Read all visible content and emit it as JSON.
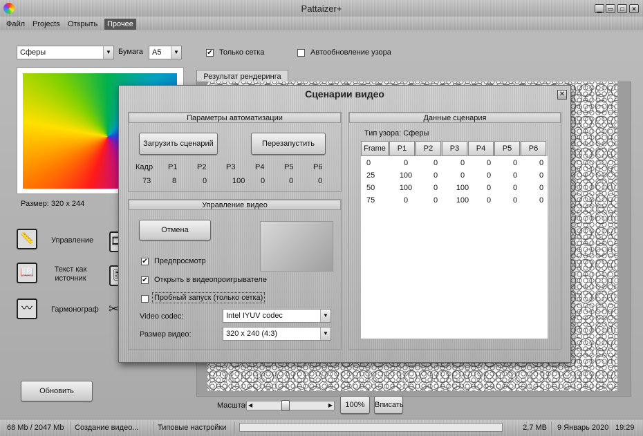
{
  "app": {
    "title": "Pattaizer+"
  },
  "window_buttons": {
    "minimize": "▁",
    "restore": "▭",
    "maximize": "□",
    "close": "✕"
  },
  "menu": [
    {
      "label": "Файл"
    },
    {
      "label": "Projects"
    },
    {
      "label": "Открыть"
    },
    {
      "label": "Прочее"
    }
  ],
  "toolbar": {
    "pattern_select": "Сферы",
    "paper_label": "Бумага",
    "paper_select": "A5",
    "only_grid_label": "Только сетка",
    "only_grid_checked": true,
    "auto_update_label": "Автообновление узора",
    "auto_update_checked": false
  },
  "left_panel": {
    "size_label": "Размер: 320 x 244",
    "features": [
      {
        "label": "Управление",
        "icon": "ruler-icon"
      },
      {
        "label": "Текст как источник",
        "icon": "book-icon"
      },
      {
        "label": "Гармонограф",
        "icon": "waveform-icon"
      }
    ],
    "refresh_button": "Обновить"
  },
  "render": {
    "tab_label": "Результат рендеринга",
    "scale_label": "Масштаб",
    "zoom_100": "100%",
    "fit_button": "Вписать"
  },
  "dialog": {
    "title": "Сценарии видео",
    "automation": {
      "header": "Параметры автоматизации",
      "load_button": "Загрузить сценарий",
      "restart_button": "Перезапустить",
      "headers": [
        "Кадр",
        "P1",
        "P2",
        "P3",
        "P4",
        "P5",
        "P6"
      ],
      "values": [
        "73",
        "8",
        "0",
        "100",
        "0",
        "0",
        "0"
      ]
    },
    "video": {
      "header": "Управление видео",
      "cancel_button": "Отмена",
      "preview_label": "Предпросмотр",
      "preview_checked": true,
      "open_player_label": "Открыть в видеопроигрывателе",
      "open_player_checked": true,
      "trial_label": "Пробный запуск (только сетка)",
      "trial_checked": false,
      "codec_label": "Video codec:",
      "codec_value": "Intel IYUV codec",
      "size_label": "Размер видео:",
      "size_value": "320 x 240 (4:3)"
    },
    "scenario": {
      "header": "Данные сценария",
      "pattern_type": "Тип узора: Сферы",
      "columns": [
        "Frame",
        "P1",
        "P2",
        "P3",
        "P4",
        "P5",
        "P6"
      ],
      "rows": [
        [
          "0",
          "0",
          "0",
          "0",
          "0",
          "0",
          "0"
        ],
        [
          "25",
          "100",
          "0",
          "0",
          "0",
          "0",
          "0"
        ],
        [
          "50",
          "100",
          "0",
          "100",
          "0",
          "0",
          "0"
        ],
        [
          "75",
          "0",
          "0",
          "100",
          "0",
          "0",
          "0"
        ]
      ]
    }
  },
  "status": {
    "memory": "68 Mb / 2047 Mb",
    "task": "Создание видео...",
    "settings": "Типовые настройки",
    "progress": 0,
    "file_size": "2,7 MB",
    "date": "9 Январь 2020",
    "time": "19:29"
  }
}
